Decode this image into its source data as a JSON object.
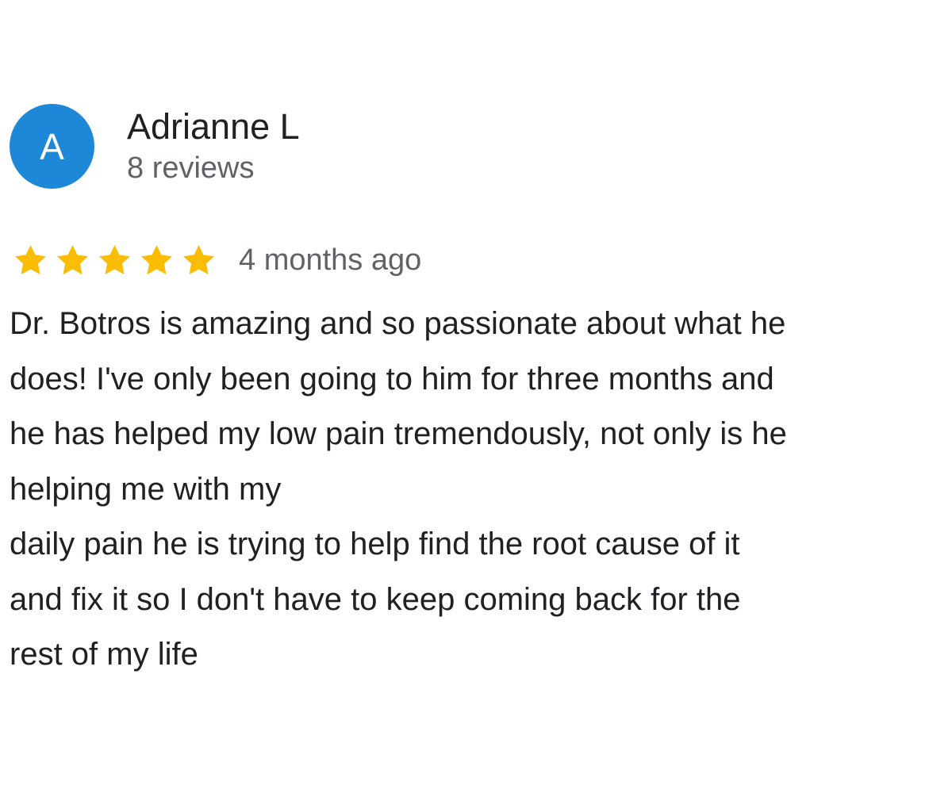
{
  "review": {
    "avatar_initial": "A",
    "avatar_color": "#1e88d8",
    "author_name": "Adrianne L",
    "review_count": "8 reviews",
    "rating": 5,
    "rating_max": 5,
    "star_color": "#fbbc04",
    "time_ago": "4 months ago",
    "text_lines": [
      "Dr. Botros is amazing and so passionate about what he",
      "does! I've only been going to him for three months and",
      "he has helped my low pain tremendously, not only is he",
      "helping me with my",
      "daily pain he is trying to help find the root cause of it",
      "and fix it so I don't have to keep coming back for the",
      "rest of my life"
    ]
  }
}
